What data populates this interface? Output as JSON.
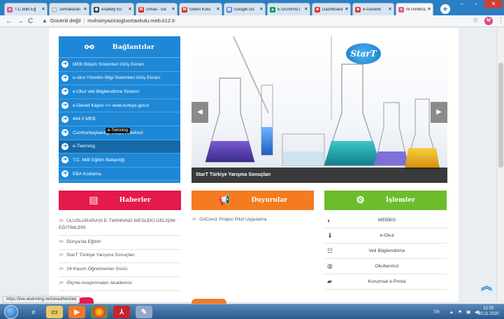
{
  "browser": {
    "tabs": [
      {
        "title": "T.C.Millî Eğ",
        "fav_color": "#e05c8a",
        "fav_glyph": "●",
        "active": false
      },
      {
        "title": "zehrakaratı",
        "fav_color": "#c8c8c8",
        "fav_glyph": "▲",
        "active": false
      },
      {
        "title": "eSafety Eti",
        "fav_color": "#333333",
        "fav_glyph": "◉",
        "active": false
      },
      {
        "title": "Gmail - Ge",
        "fav_color": "#d93025",
        "fav_glyph": "M",
        "active": false
      },
      {
        "title": "Gelen Kutu",
        "fav_color": "#d93025",
        "fav_glyph": "M",
        "active": false
      },
      {
        "title": "Google Do",
        "fav_color": "#4285f4",
        "fav_glyph": "▤",
        "active": false
      },
      {
        "title": "E-GÜVENLİ",
        "fav_color": "#0f9d58",
        "fav_glyph": "▲",
        "active": false
      },
      {
        "title": "Dashboard",
        "fav_color": "#e53935",
        "fav_glyph": "■",
        "active": false
      },
      {
        "title": "e-Güvenli",
        "fav_color": "#e53935",
        "fav_glyph": "■",
        "active": false
      },
      {
        "title": "İSTANBUL",
        "fav_color": "#e05c8a",
        "fav_glyph": "●",
        "active": true
      }
    ],
    "security_label": "Güvenli değil",
    "url": "muhsinyaziciogluortaokulu.meb.k12.tr",
    "profile_initial": "M",
    "status_url": "https://live.etwinning.net/unauthorized"
  },
  "sidebar": {
    "title": "Bağlantılar",
    "items": [
      "MEB Bilişim Sistemleri Giriş Ekranı",
      "e-okul Yönetim Bilgi Sistemleri Giriş Ekranı",
      "e-Okul Veli Bilgilendirme Sistemi",
      "e-Devlet Kapısı >> www.turkiye.gov.tr",
      "444 0 MEB",
      "Cumhurbaşkanlığı İletişim Merkezi",
      "e-Twinning",
      "T.C. Millî Eğitim Bakanlığı",
      "EBA Kodlama"
    ],
    "tooltip": "e-Twinning"
  },
  "slider": {
    "caption": "StarT Türkiye Yarışma Sonuçları",
    "logo_text": "StarT"
  },
  "haberler": {
    "title": "Haberler",
    "items": [
      "ULUSLARARASI E-TWINNING MESLEKİ GELİŞİM EĞİTİMLERİ",
      "Dünya'da Eğitim",
      "StarT Türkiye Yarışma Sonuçları",
      "24 Kasım Öğretmenler Günü",
      "Ölçme-Araştırmaları Akademisi"
    ]
  },
  "duyurular": {
    "title": "Duyurular",
    "items": [
      "GriCeviz Projesi Pilot Uygulama"
    ]
  },
  "islemler": {
    "title": "İşlemler",
    "items": [
      "MEBBİS",
      "e-Okul",
      "Veli Bilgilendirme",
      "Okullarımız",
      "Kurumsal e-Posta"
    ]
  },
  "taskbar": {
    "lang": "TR",
    "time": "12:33",
    "date": "30.11.2020"
  },
  "colors": {
    "baglantilar": "#1e88d6",
    "haberler": "#e6194b",
    "duyurular": "#f47b20",
    "islemler": "#6cbd2b"
  }
}
